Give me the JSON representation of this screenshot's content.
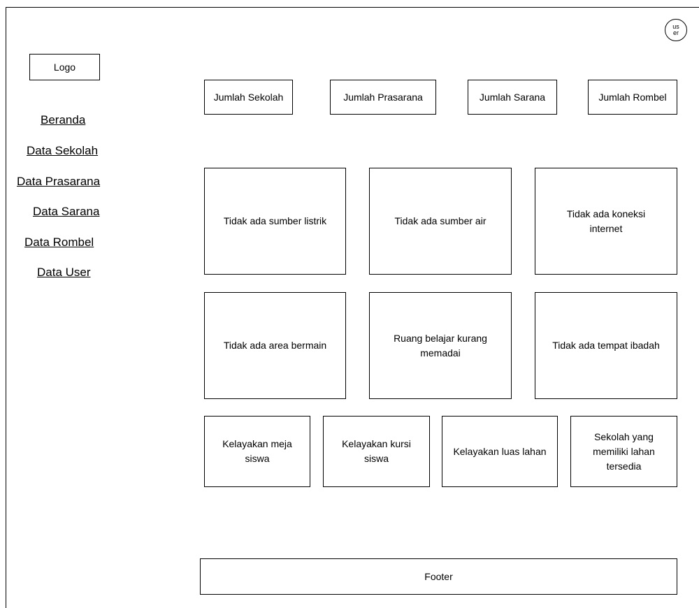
{
  "header": {
    "logo": "Logo",
    "user": "user"
  },
  "sidebar": {
    "items": [
      {
        "label": "Beranda"
      },
      {
        "label": "Data Sekolah"
      },
      {
        "label": "Data Prasarana"
      },
      {
        "label": "Data Sarana"
      },
      {
        "label": "Data Rombel"
      },
      {
        "label": "Data User"
      }
    ]
  },
  "stats": [
    {
      "label": "Jumlah Sekolah"
    },
    {
      "label": "Jumlah Prasarana"
    },
    {
      "label": "Jumlah Sarana"
    },
    {
      "label": "Jumlah Rombel"
    }
  ],
  "cards_row1": [
    {
      "label": "Tidak ada sumber listrik"
    },
    {
      "label": "Tidak ada sumber air"
    },
    {
      "label": "Tidak ada koneksi internet"
    }
  ],
  "cards_row2": [
    {
      "label": "Tidak ada area bermain"
    },
    {
      "label": "Ruang belajar kurang memadai"
    },
    {
      "label": "Tidak ada tempat ibadah"
    }
  ],
  "cards_row3": [
    {
      "label": "Kelayakan meja siswa"
    },
    {
      "label": "Kelayakan kursi siswa"
    },
    {
      "label": "Kelayakan luas lahan"
    },
    {
      "label": "Sekolah yang memiliki lahan tersedia"
    }
  ],
  "footer": {
    "label": "Footer"
  }
}
